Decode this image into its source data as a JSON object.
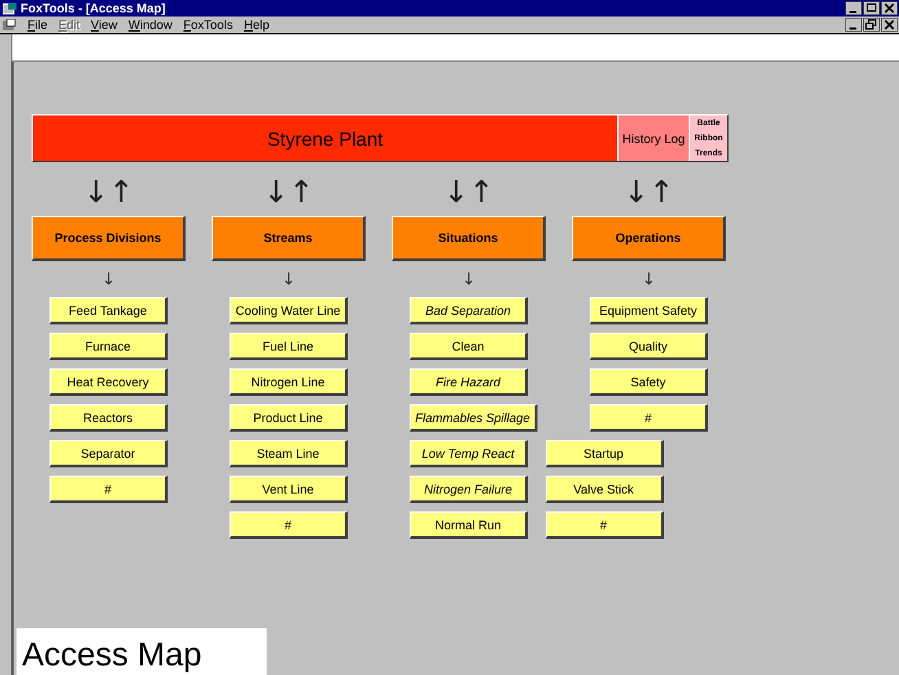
{
  "window": {
    "title": "FoxTools - [Access Map]"
  },
  "menu": [
    {
      "label": "File",
      "disabled": false
    },
    {
      "label": "Edit",
      "disabled": true
    },
    {
      "label": "View",
      "disabled": false
    },
    {
      "label": "Window",
      "disabled": false
    },
    {
      "label": "FoxTools",
      "disabled": false
    },
    {
      "label": "Help",
      "disabled": false
    }
  ],
  "plant_bar": {
    "title": "Styrene Plant",
    "history": "History Log",
    "tools": [
      "Battle",
      "Ribbon",
      "Trends"
    ]
  },
  "columns": [
    {
      "link_arrows": "↓↑",
      "header": "Process Divisions",
      "down_arrow": "↓",
      "items": [
        {
          "label": "Feed Tankage",
          "italic": false
        },
        {
          "label": "Furnace",
          "italic": false
        },
        {
          "label": "Heat Recovery",
          "italic": false
        },
        {
          "label": "Reactors",
          "italic": false
        },
        {
          "label": "Separator",
          "italic": false
        },
        {
          "label": "#",
          "italic": false
        }
      ]
    },
    {
      "link_arrows": "↓↑",
      "header": "Streams",
      "down_arrow": "↓",
      "items": [
        {
          "label": "Cooling Water Line",
          "italic": false
        },
        {
          "label": "Fuel Line",
          "italic": false
        },
        {
          "label": "Nitrogen Line",
          "italic": false
        },
        {
          "label": "Product Line",
          "italic": false
        },
        {
          "label": "Steam Line",
          "italic": false
        },
        {
          "label": "Vent Line",
          "italic": false
        },
        {
          "label": "#",
          "italic": false
        }
      ]
    },
    {
      "link_arrows": "↓↑",
      "header": "Situations",
      "down_arrow": "↓",
      "items": [
        {
          "label": "Bad Separation",
          "italic": true
        },
        {
          "label": "Clean",
          "italic": false
        },
        {
          "label": "Fire Hazard",
          "italic": true
        },
        {
          "label": "Flammables Spillage",
          "italic": true
        },
        {
          "label": "Low Temp React",
          "italic": true
        },
        {
          "label": "Nitrogen Failure",
          "italic": true
        },
        {
          "label": "Normal Run",
          "italic": false
        }
      ],
      "side_items": [
        {
          "label": "Startup",
          "italic": false
        },
        {
          "label": "Valve Stick",
          "italic": false
        },
        {
          "label": "#",
          "italic": false
        }
      ]
    },
    {
      "link_arrows": "↓↑",
      "header": "Operations",
      "down_arrow": "↓",
      "items": [
        {
          "label": "Equipment Safety",
          "italic": false
        },
        {
          "label": "Quality",
          "italic": false
        },
        {
          "label": "Safety",
          "italic": false
        },
        {
          "label": "#",
          "italic": false
        }
      ]
    }
  ],
  "caption": "Access Map"
}
